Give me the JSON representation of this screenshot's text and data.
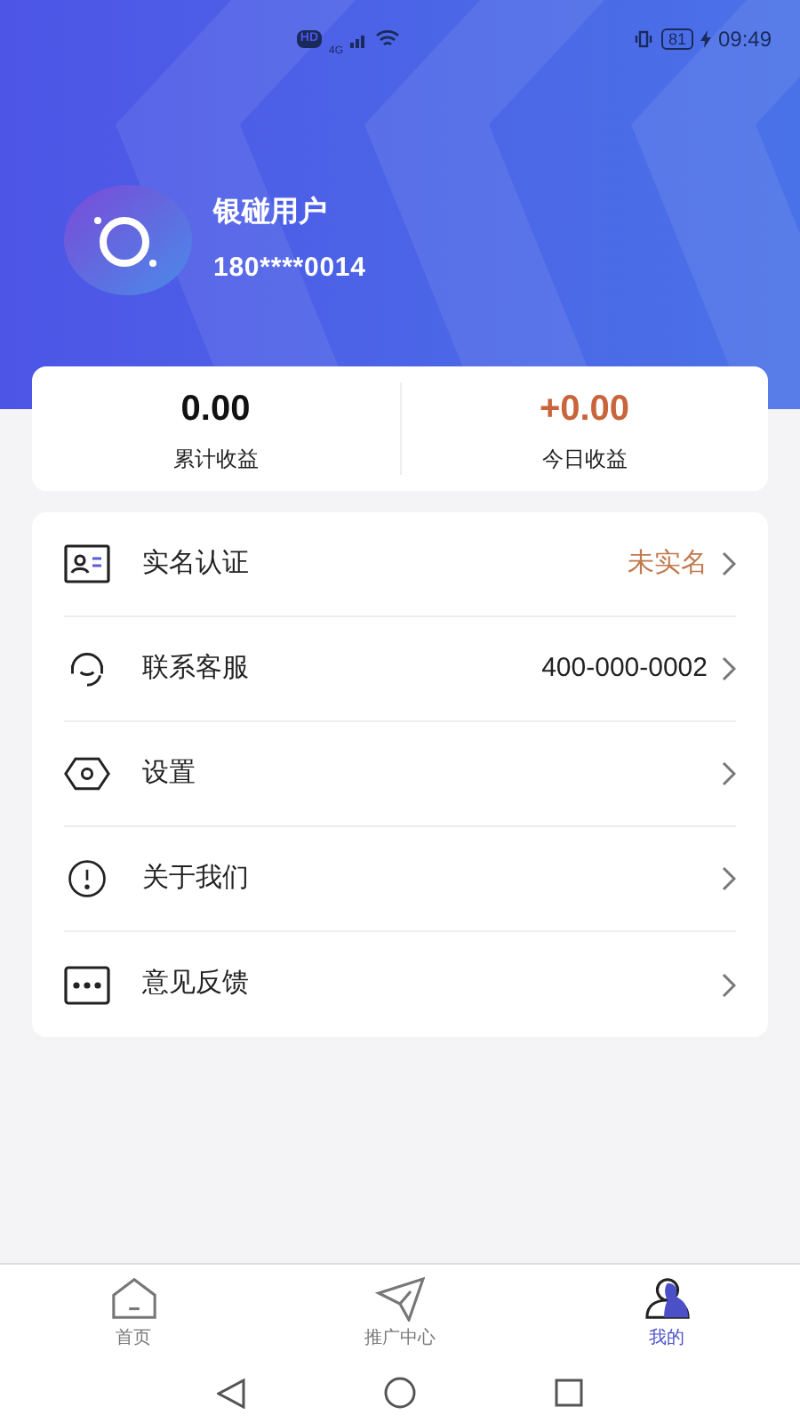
{
  "status_bar": {
    "hd": "HD",
    "network": "4G",
    "battery": "81",
    "time": "09:49"
  },
  "profile": {
    "name": "银碰用户",
    "phone": "180****0014"
  },
  "earnings": [
    {
      "value": "0.00",
      "label": "累计收益",
      "highlight": false
    },
    {
      "value": "+0.00",
      "label": "今日收益",
      "highlight": true
    }
  ],
  "menu": [
    {
      "label": "实名认证",
      "value": "未实名",
      "highlight": true
    },
    {
      "label": "联系客服",
      "value": "400-000-0002",
      "highlight": false
    },
    {
      "label": "设置"
    },
    {
      "label": "关于我们"
    },
    {
      "label": "意见反馈"
    }
  ],
  "tab_bar": [
    {
      "label": "首页",
      "selected": false
    },
    {
      "label": "推广中心",
      "selected": false
    },
    {
      "label": "我的",
      "selected": true
    }
  ]
}
